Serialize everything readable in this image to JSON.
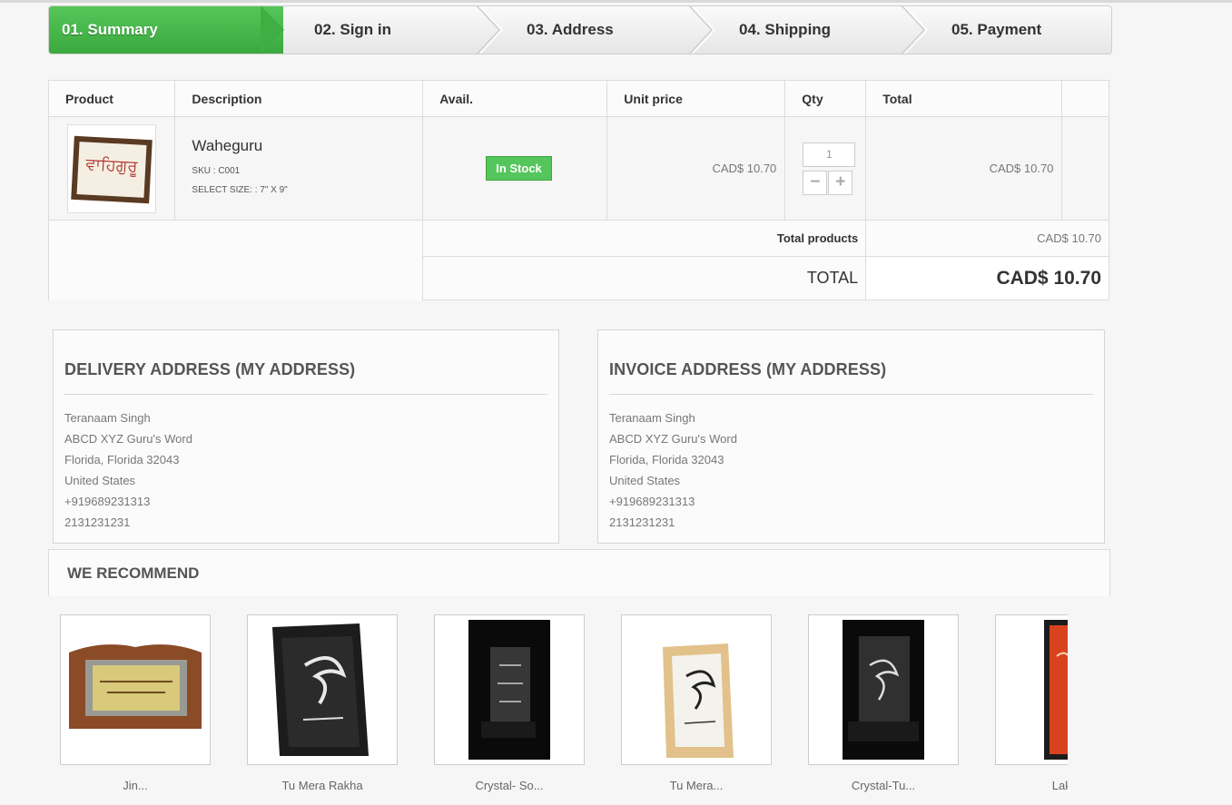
{
  "steps": [
    "01. Summary",
    "02. Sign in",
    "03. Address",
    "04. Shipping",
    "05. Payment"
  ],
  "cart": {
    "headers": {
      "product": "Product",
      "description": "Description",
      "avail": "Avail.",
      "unit_price": "Unit price",
      "qty": "Qty",
      "total": "Total"
    },
    "item": {
      "thumb_text": "ਵਾਹਿਗੁਰੂ",
      "name": "Waheguru",
      "sku": "SKU : C001",
      "size": "SELECT SIZE: : 7\" X 9\"",
      "availability": "In Stock",
      "unit_price": "CAD$ 10.70",
      "qty": "1",
      "minus": "−",
      "plus": "+",
      "total": "CAD$ 10.70"
    },
    "total_products_label": "Total products",
    "total_products": "CAD$ 10.70",
    "total_label": "TOTAL",
    "total": "CAD$ 10.70"
  },
  "delivery": {
    "title": "DELIVERY ADDRESS (MY ADDRESS)",
    "lines": [
      "Teranaam Singh",
      "ABCD XYZ Guru's Word",
      "Florida, Florida 32043",
      "United States",
      "+919689231313",
      "2131231231"
    ]
  },
  "invoice": {
    "title": "INVOICE ADDRESS (MY ADDRESS)",
    "lines": [
      "Teranaam Singh",
      "ABCD XYZ Guru's Word",
      "Florida, Florida 32043",
      "United States",
      "+919689231313",
      "2131231231"
    ]
  },
  "recommend": {
    "title": "WE RECOMMEND",
    "items": [
      {
        "name": "Jin..."
      },
      {
        "name": "Tu Mera Rakha"
      },
      {
        "name": "Crystal- So..."
      },
      {
        "name": "Tu Mera..."
      },
      {
        "name": "Crystal-Tu..."
      },
      {
        "name": "Lakh K"
      }
    ]
  },
  "colors": {
    "accent": "#4cb94f",
    "stock_bg": "#55c65b"
  }
}
